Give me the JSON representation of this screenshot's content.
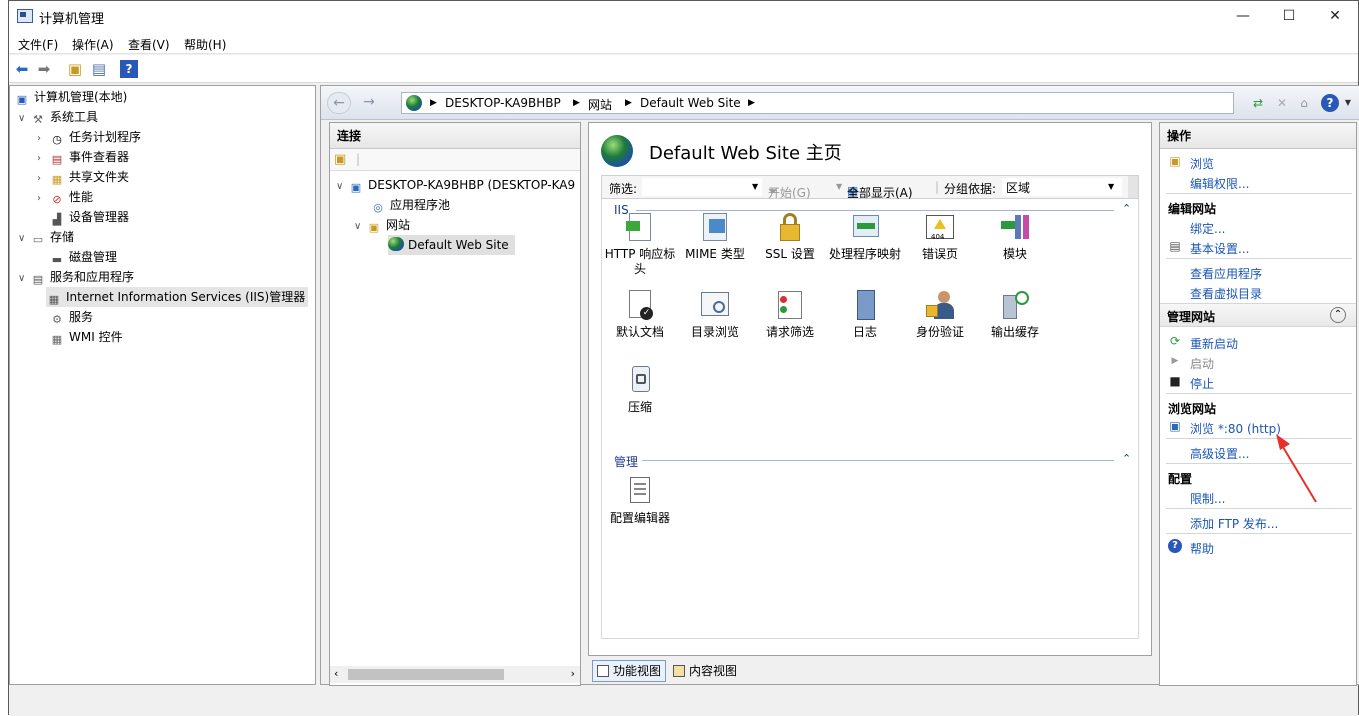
{
  "window": {
    "title": "计算机管理"
  },
  "menu": [
    "文件(F)",
    "操作(A)",
    "查看(V)",
    "帮助(H)"
  ],
  "tree": {
    "root": "计算机管理(本地)",
    "items": [
      {
        "label": "系统工具"
      },
      {
        "label": "任务计划程序"
      },
      {
        "label": "事件查看器"
      },
      {
        "label": "共享文件夹"
      },
      {
        "label": "性能"
      },
      {
        "label": "设备管理器"
      },
      {
        "label": "存储"
      },
      {
        "label": "磁盘管理"
      },
      {
        "label": "服务和应用程序"
      },
      {
        "label": "Internet Information Services (IIS)管理器"
      },
      {
        "label": "服务"
      },
      {
        "label": "WMI 控件"
      }
    ]
  },
  "address": {
    "parts": [
      "DESKTOP-KA9BHBP",
      "网站",
      "Default Web Site"
    ]
  },
  "connections": {
    "header": "连接",
    "server": "DESKTOP-KA9BHBP (DESKTOP-KA9",
    "app_pool": "应用程序池",
    "sites": "网站",
    "site": "Default Web Site"
  },
  "center": {
    "title": "Default Web Site 主页",
    "filter_label": "筛选:",
    "start_label": "开始(G)",
    "show_all": "全部显示(A)",
    "group_by": "分组依据:",
    "group_value": "区域",
    "group_iis": "IIS",
    "group_manage": "管理",
    "features_iis": [
      {
        "label": "HTTP 响应标头",
        "icon": "http-headers-icon"
      },
      {
        "label": "MIME 类型",
        "icon": "mime-types-icon"
      },
      {
        "label": "SSL 设置",
        "icon": "lock-icon"
      },
      {
        "label": "处理程序映射",
        "icon": "handler-mappings-icon"
      },
      {
        "label": "错误页",
        "icon": "error-pages-icon"
      },
      {
        "label": "模块",
        "icon": "modules-icon"
      },
      {
        "label": "默认文档",
        "icon": "default-document-icon"
      },
      {
        "label": "目录浏览",
        "icon": "directory-browsing-icon"
      },
      {
        "label": "请求筛选",
        "icon": "request-filtering-icon"
      },
      {
        "label": "日志",
        "icon": "logging-icon"
      },
      {
        "label": "身份验证",
        "icon": "authentication-icon"
      },
      {
        "label": "输出缓存",
        "icon": "output-caching-icon"
      },
      {
        "label": "压缩",
        "icon": "compression-icon"
      }
    ],
    "features_manage": [
      {
        "label": "配置编辑器",
        "icon": "configuration-editor-icon"
      }
    ]
  },
  "view_tabs": {
    "features": "功能视图",
    "content": "内容视图"
  },
  "actions": {
    "header": "操作",
    "browse": "浏览",
    "edit_permissions": "编辑权限...",
    "edit_site": "编辑网站",
    "bindings": "绑定...",
    "basic_settings": "基本设置...",
    "view_apps": "查看应用程序",
    "view_vdirs": "查看虚拟目录",
    "manage_site": "管理网站",
    "restart": "重新启动",
    "start": "启动",
    "stop": "停止",
    "browse_site": "浏览网站",
    "browse_80": "浏览 *:80 (http)",
    "advanced_settings": "高级设置...",
    "config": "配置",
    "limits": "限制...",
    "add_ftp": "添加 FTP 发布...",
    "help": "帮助"
  },
  "colors": {
    "link": "#1a56b8",
    "arrow": "#e8302a"
  }
}
